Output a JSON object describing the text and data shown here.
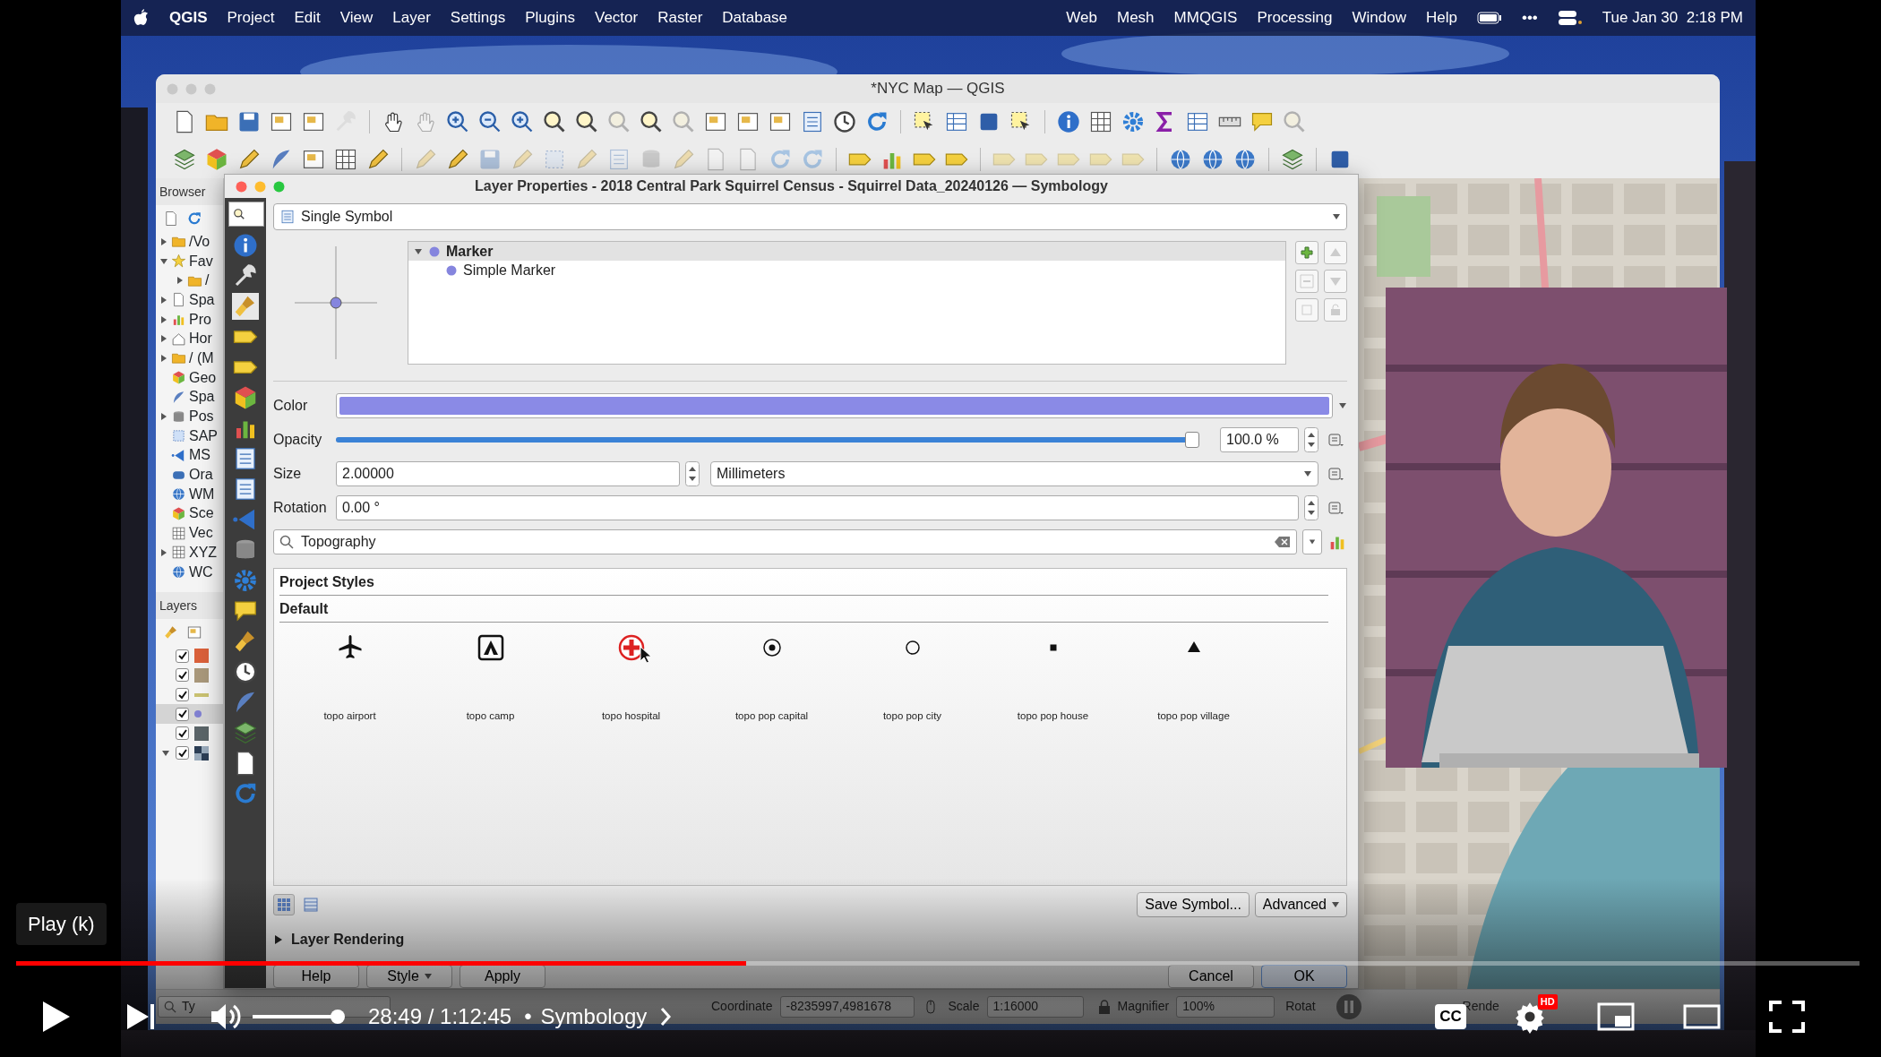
{
  "menu_bar": {
    "app": "QGIS",
    "menus": [
      "Project",
      "Edit",
      "View",
      "Layer",
      "Settings",
      "Plugins",
      "Vector",
      "Raster",
      "Database"
    ],
    "menus_right": [
      "Web",
      "Mesh",
      "MMQGIS",
      "Processing",
      "Window",
      "Help"
    ],
    "more": "•••",
    "clock": "Tue Jan 30  2:18 PM"
  },
  "qgis_window": {
    "title": "*NYC Map — QGIS"
  },
  "browser": {
    "title": "Browser",
    "items": [
      {
        "label": "/Vo",
        "expandable": true,
        "expanded": false
      },
      {
        "label": "Fav",
        "expandable": true,
        "expanded": true,
        "children": [
          {
            "label": "/",
            "expandable": true,
            "expanded": false
          }
        ]
      },
      {
        "label": "Spa",
        "expandable": true,
        "expanded": false
      },
      {
        "label": "Pro",
        "expandable": true,
        "expanded": false
      },
      {
        "label": "Hor",
        "expandable": true,
        "expanded": false
      },
      {
        "label": "/ (M",
        "expandable": true,
        "expanded": false
      },
      {
        "label": "Geo",
        "expandable": false
      },
      {
        "label": "Spa",
        "expandable": false
      },
      {
        "label": "Pos",
        "expandable": true,
        "expanded": false
      },
      {
        "label": "SAP",
        "expandable": false
      },
      {
        "label": "MS",
        "expandable": false
      },
      {
        "label": "Ora",
        "expandable": false
      },
      {
        "label": "WM",
        "expandable": false
      },
      {
        "label": "Sce",
        "expandable": false
      },
      {
        "label": "Vec",
        "expandable": false
      },
      {
        "label": "XYZ",
        "expandable": true,
        "expanded": false
      },
      {
        "label": "WC",
        "expandable": false
      }
    ]
  },
  "layers": {
    "title": "Layers",
    "items": [
      {
        "kind": "fill",
        "color": "#d9603a",
        "checked": true,
        "selected": false,
        "expandable": false
      },
      {
        "kind": "fill",
        "color": "#a8977a",
        "checked": true,
        "selected": false,
        "expandable": false
      },
      {
        "kind": "line",
        "color": "#c8c070",
        "checked": true,
        "selected": false,
        "expandable": false
      },
      {
        "kind": "point",
        "color": "#7f7fd0",
        "checked": true,
        "selected": true,
        "expandable": false
      },
      {
        "kind": "fill",
        "color": "#5a6468",
        "checked": true,
        "selected": false,
        "expandable": false
      },
      {
        "kind": "raster",
        "color": "#2c3e55",
        "checked": true,
        "selected": false,
        "expandable": true,
        "expanded": true
      }
    ]
  },
  "dialog": {
    "title": "Layer Properties - 2018 Central Park Squirrel Census - Squirrel Data_20240126 — Symbology",
    "renderer": "Single Symbol",
    "symbol_tree": [
      {
        "label": "Marker",
        "expanded": true,
        "color": "#8585de",
        "children": [
          {
            "label": "Simple Marker",
            "color": "#8585de"
          }
        ]
      }
    ],
    "properties": {
      "color": {
        "label": "Color",
        "color": "#8a8ae6"
      },
      "opacity": {
        "label": "Opacity",
        "level": 1,
        "value": "100.0 %"
      },
      "size": {
        "label": "Size",
        "value": "2.00000",
        "unit": "Millimeters"
      },
      "rotation": {
        "label": "Rotation",
        "value": "0.00 °"
      }
    },
    "style_search": {
      "value": "Topography"
    },
    "groups": [
      "Project Styles",
      "Default"
    ],
    "symbols": [
      {
        "label": "topo airport",
        "pointer": false
      },
      {
        "label": "topo camp",
        "pointer": false
      },
      {
        "label": "topo hospital",
        "pointer": true
      },
      {
        "label": "topo pop capital",
        "pointer": false
      },
      {
        "label": "topo pop city",
        "pointer": false
      },
      {
        "label": "topo pop house",
        "pointer": false
      },
      {
        "label": "topo pop village",
        "pointer": false
      }
    ],
    "view_buttons": [
      {
        "selected": true
      },
      {
        "selected": false
      }
    ],
    "save_button": "Save Symbol...",
    "advanced_button": "Advanced",
    "layer_rendering": {
      "label": "Layer Rendering",
      "expanded": false
    },
    "buttons": [
      {
        "label": "Help",
        "kind": "plain"
      },
      {
        "label": "Style",
        "kind": "dropdown"
      },
      {
        "label": "Apply",
        "kind": "plain"
      },
      {
        "label": "Cancel",
        "kind": "plain"
      },
      {
        "label": "OK",
        "kind": "default"
      }
    ]
  },
  "status_bar": {
    "locator": "Ty",
    "coordinate_label": "Coordinate",
    "coordinate": "-8235997,4981678",
    "scale_label": "Scale",
    "scale": "1:16000",
    "magnifier_label": "Magnifier",
    "magnifier": "100%",
    "rotation_label": "Rotat",
    "render_label": "Rende"
  },
  "player": {
    "tooltip": "Play (k)",
    "progress": {
      "level": 0.396
    },
    "volume": {
      "level": 1
    },
    "time": "28:49 / 1:12:45",
    "separator": "•",
    "chapter": "Symbology",
    "cc": "CC",
    "hd": "HD"
  }
}
